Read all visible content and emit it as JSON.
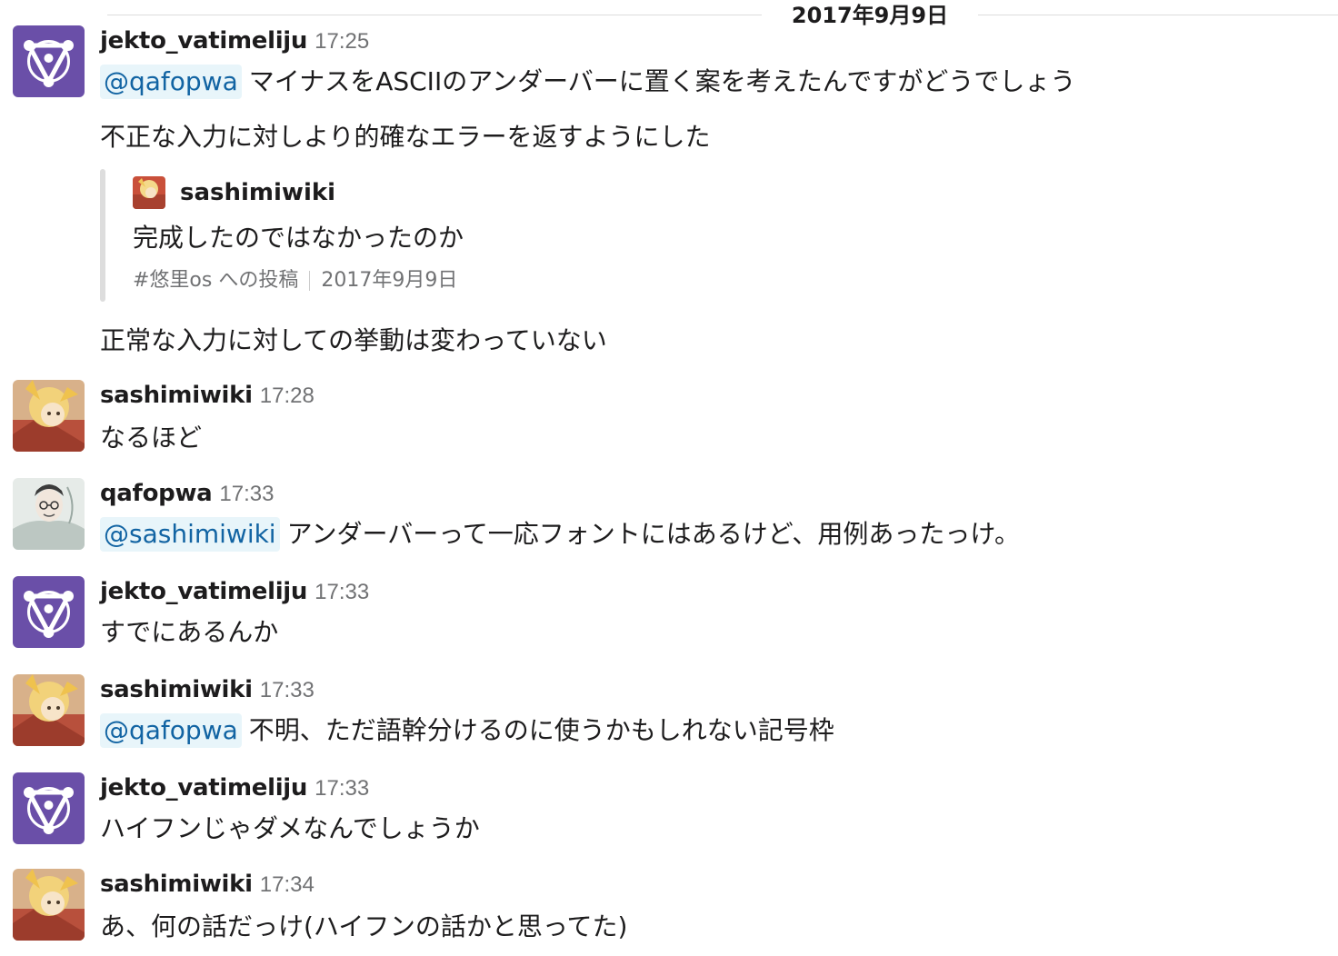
{
  "date_divider": "2017年9月9日",
  "messages": [
    {
      "user": "jekto_vatimeliju",
      "time": "17:25",
      "avatar": "purple-triangle-logo",
      "mention": "@qafopwa",
      "text": "マイナスをASCIIのアンダーバーに置く案を考えたんですがどうでしょう",
      "text2": "不正な入力に対しより的確なエラーを返すようにした",
      "quote": {
        "author": "sashimiwiki",
        "text": "完成したのではなかったのか",
        "source": "#悠里os への投稿",
        "date": "2017年9月9日"
      },
      "text3": "正常な入力に対しての挙動は変わっていない"
    },
    {
      "user": "sashimiwiki",
      "time": "17:28",
      "avatar": "anime-character-avatar",
      "text": "なるほど"
    },
    {
      "user": "qafopwa",
      "time": "17:33",
      "avatar": "sketch-portrait-avatar",
      "mention": "@sashimiwiki",
      "text": "アンダーバーって一応フォントにはあるけど、用例あったっけ。"
    },
    {
      "user": "jekto_vatimeliju",
      "time": "17:33",
      "avatar": "purple-triangle-logo",
      "text": "すでにあるんか"
    },
    {
      "user": "sashimiwiki",
      "time": "17:33",
      "avatar": "anime-character-avatar",
      "mention": "@qafopwa",
      "text": "不明、ただ語幹分けるのに使うかもしれない記号枠"
    },
    {
      "user": "jekto_vatimeliju",
      "time": "17:33",
      "avatar": "purple-triangle-logo",
      "text": "ハイフンじゃダメなんでしょうか"
    },
    {
      "user": "sashimiwiki",
      "time": "17:34",
      "avatar": "anime-character-avatar",
      "text": "あ、何の話だっけ(ハイフンの話かと思ってた)"
    }
  ],
  "colors": {
    "mention_bg": "#e8f5fa",
    "mention_fg": "#1264a3",
    "avatar_purple": "#6a4fa8",
    "timestamp": "#717274"
  }
}
